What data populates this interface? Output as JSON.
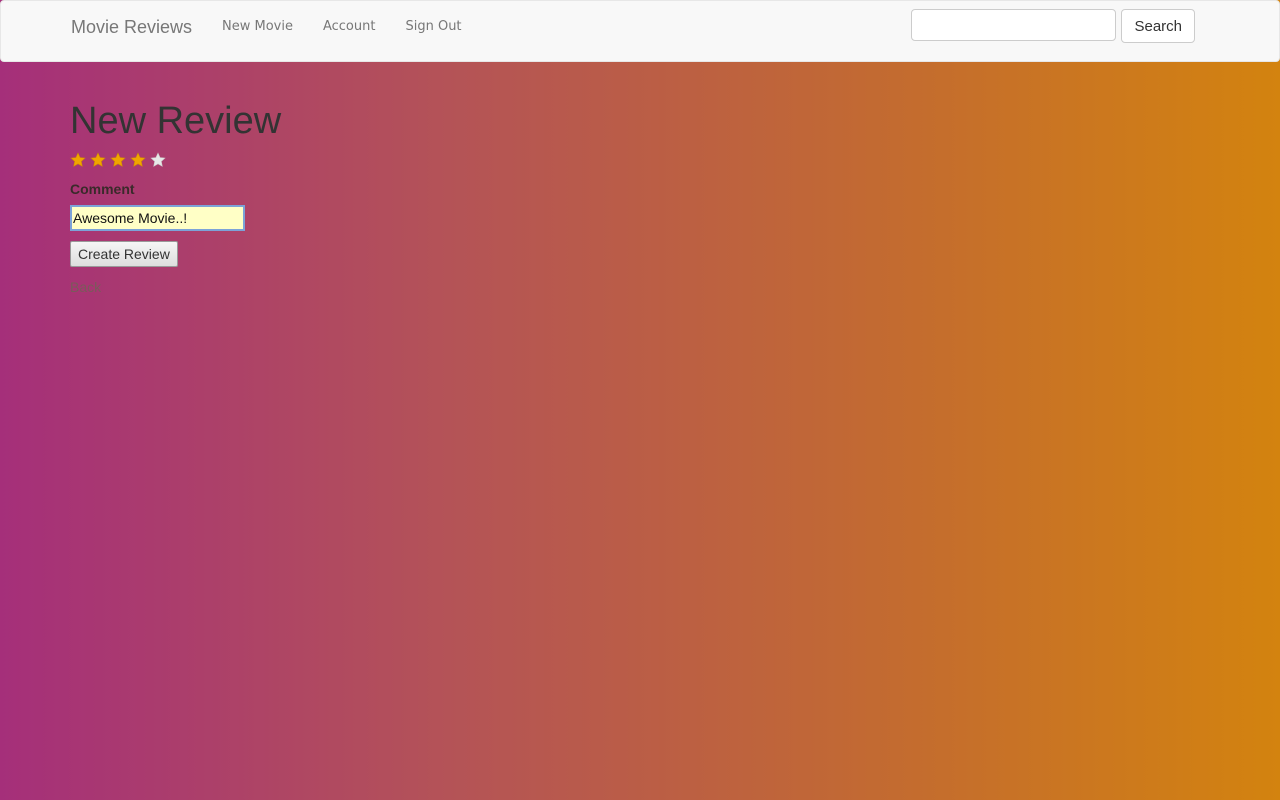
{
  "navbar": {
    "brand": "Movie Reviews",
    "links": [
      "New Movie",
      "Account",
      "Sign Out"
    ],
    "search": {
      "value": "",
      "button_label": "Search"
    }
  },
  "page": {
    "title": "New Review",
    "rating": {
      "value": 4,
      "max": 5,
      "filled_color": "#f0a500",
      "empty_color": "#e8e8e8"
    },
    "comment_label": "Comment",
    "comment_value": "Awesome Movie..!",
    "submit_label": "Create Review",
    "back_label": "Back"
  },
  "colors": {
    "gradient_start": "#a52f7a",
    "gradient_end": "#d3830f"
  }
}
